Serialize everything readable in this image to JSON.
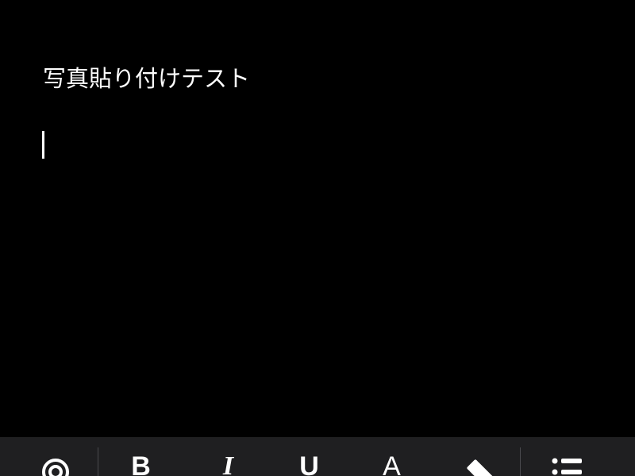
{
  "document": {
    "line1": "写真貼り付けテスト"
  },
  "toolbar": {
    "buttons": [
      {
        "name": "camera-icon",
        "label": ""
      },
      {
        "name": "bold-icon",
        "label": "B"
      },
      {
        "name": "italic-icon",
        "label": "I"
      },
      {
        "name": "underline-icon",
        "label": "U"
      },
      {
        "name": "font-color-icon",
        "label": "A"
      },
      {
        "name": "highlight-pen-icon",
        "label": ""
      },
      {
        "name": "bullet-list-icon",
        "label": ""
      }
    ]
  },
  "colors": {
    "background": "#000000",
    "toolbar": "#1f1f21",
    "text": "#ffffff",
    "separator": "#4a4a4e"
  }
}
